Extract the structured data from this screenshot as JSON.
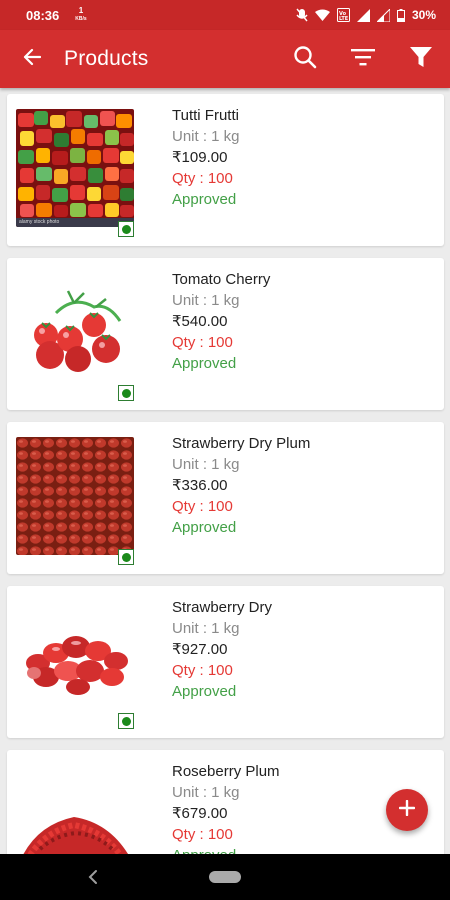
{
  "status_bar": {
    "time": "08:36",
    "net_speed_value": "1",
    "net_speed_unit": "KB/s",
    "battery": "30%"
  },
  "app_bar": {
    "title": "Products",
    "icons": [
      "back-arrow-icon",
      "search-icon",
      "sort-icon",
      "filter-icon"
    ]
  },
  "products": [
    {
      "name": "Tutti Frutti",
      "unit": "Unit : 1 kg",
      "price": "₹109.00",
      "qty": "Qty : 100",
      "status": "Approved",
      "image_watermark": "alamy stock photo"
    },
    {
      "name": "Tomato Cherry",
      "unit": "Unit : 1 kg",
      "price": "₹540.00",
      "qty": "Qty : 100",
      "status": "Approved"
    },
    {
      "name": "Strawberry Dry Plum",
      "unit": "Unit : 1 kg",
      "price": "₹336.00",
      "qty": "Qty : 100",
      "status": "Approved"
    },
    {
      "name": "Strawberry Dry",
      "unit": "Unit : 1 kg",
      "price": "₹927.00",
      "qty": "Qty : 100",
      "status": "Approved"
    },
    {
      "name": "Roseberry Plum",
      "unit": "Unit : 1 kg",
      "price": "₹679.00",
      "qty": "Qty : 100",
      "status": "Approved"
    }
  ],
  "colors": {
    "primary": "#d32f2f",
    "status_bar": "#c62828",
    "qty": "#e53935",
    "approved": "#43a047",
    "veg_mark": "#1b8a1b"
  },
  "fab": {
    "icon": "plus-icon"
  }
}
